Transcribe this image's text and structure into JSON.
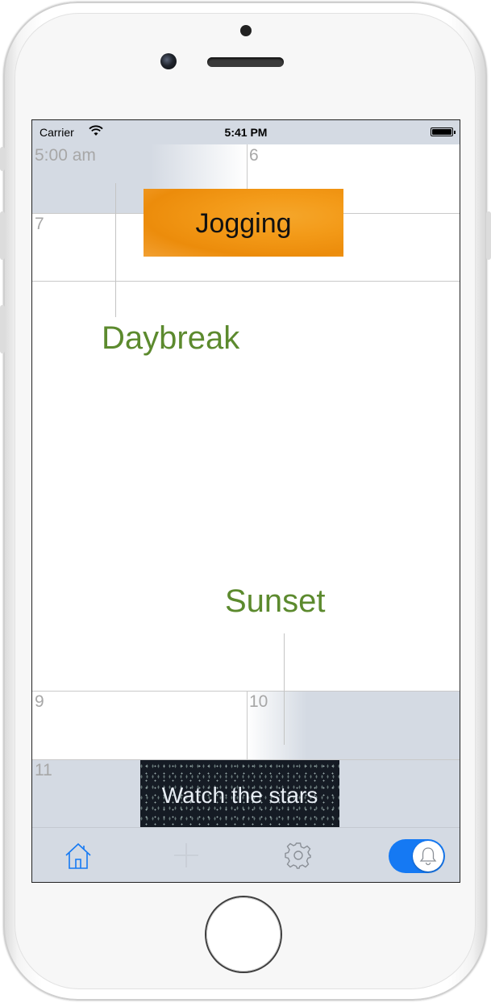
{
  "status_bar": {
    "carrier": "Carrier",
    "time": "5:41 PM"
  },
  "calendar": {
    "hours": [
      {
        "label": "5:00 am"
      },
      {
        "label": "6"
      },
      {
        "label": "7"
      },
      {
        "label": "9"
      },
      {
        "label": "10"
      },
      {
        "label": "11"
      }
    ],
    "events": [
      {
        "title": "Jogging",
        "color": "#f39a18"
      },
      {
        "title": "Watch the stars",
        "color": "#151b24"
      }
    ],
    "markers": [
      {
        "label": "Daybreak",
        "color": "#5c8a2e"
      },
      {
        "label": "Sunset",
        "color": "#5c8a2e"
      }
    ]
  },
  "tab_bar": {
    "items": [
      {
        "icon": "home-icon",
        "active": true,
        "color": "#1579f3"
      },
      {
        "icon": "plus-icon",
        "active": false,
        "color": "#c9ced6"
      },
      {
        "icon": "gear-icon",
        "active": false,
        "color": "#8a8f96"
      },
      {
        "icon": "bell-icon",
        "active": false
      }
    ],
    "alarm_toggle_on": true,
    "toggle_color": "#1579f3"
  }
}
